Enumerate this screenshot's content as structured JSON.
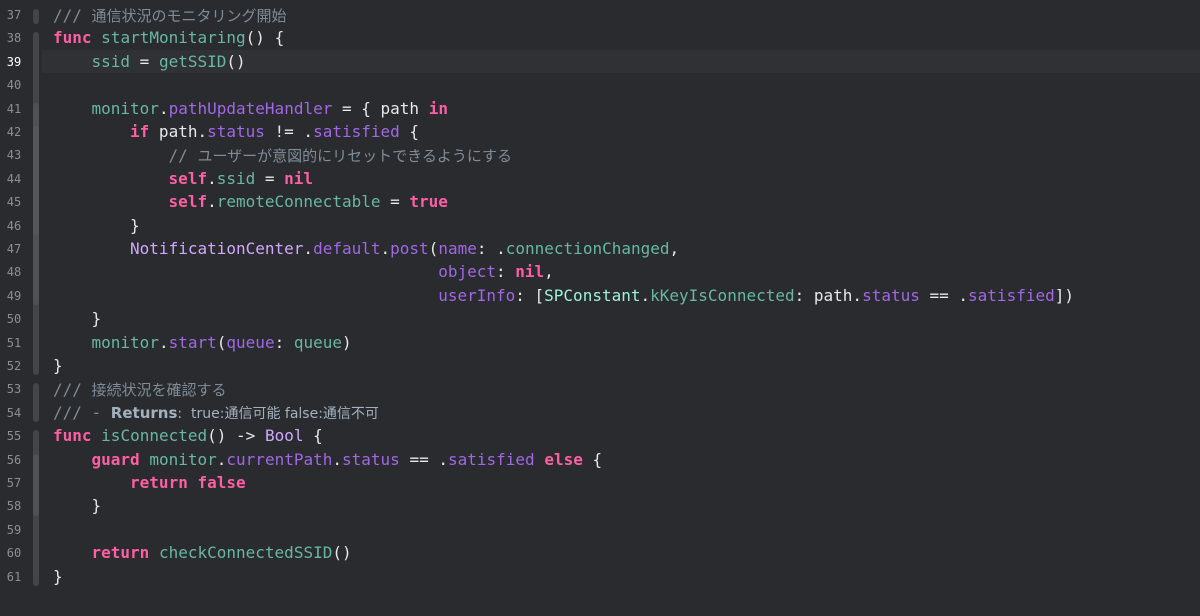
{
  "editor": {
    "active_line": "39",
    "lines": [
      {
        "n": "37",
        "indent": 1,
        "tokens": [
          {
            "t": "/// ",
            "c": "cm-mono"
          },
          {
            "t": "通信状況のモニタリング開始",
            "c": "cm"
          }
        ]
      },
      {
        "n": "38",
        "indent": 1,
        "tokens": [
          {
            "t": "func",
            "c": "kw"
          },
          {
            "t": " ",
            "c": "plain"
          },
          {
            "t": "startMonitaring",
            "c": "fn"
          },
          {
            "t": "() {",
            "c": "plain"
          }
        ]
      },
      {
        "n": "39",
        "indent": 2,
        "tokens": [
          {
            "t": "ssid",
            "c": "proj"
          },
          {
            "t": " = ",
            "c": "plain"
          },
          {
            "t": "getSSID",
            "c": "proj"
          },
          {
            "t": "()",
            "c": "plain"
          }
        ]
      },
      {
        "n": "40",
        "indent": 0,
        "tokens": []
      },
      {
        "n": "41",
        "indent": 2,
        "tokens": [
          {
            "t": "monitor",
            "c": "proj"
          },
          {
            "t": ".",
            "c": "plain"
          },
          {
            "t": "pathUpdateHandler",
            "c": "prop"
          },
          {
            "t": " = { path ",
            "c": "plain"
          },
          {
            "t": "in",
            "c": "kw"
          }
        ]
      },
      {
        "n": "42",
        "indent": 3,
        "tokens": [
          {
            "t": "if",
            "c": "kw"
          },
          {
            "t": " path.",
            "c": "plain"
          },
          {
            "t": "status",
            "c": "prop"
          },
          {
            "t": " != .",
            "c": "plain"
          },
          {
            "t": "satisfied",
            "c": "prop"
          },
          {
            "t": " {",
            "c": "plain"
          }
        ]
      },
      {
        "n": "43",
        "indent": 4,
        "tokens": [
          {
            "t": "// ",
            "c": "cm-mono"
          },
          {
            "t": "ユーザーが意図的にリセットできるようにする",
            "c": "cm"
          }
        ]
      },
      {
        "n": "44",
        "indent": 4,
        "tokens": [
          {
            "t": "self",
            "c": "kw"
          },
          {
            "t": ".",
            "c": "plain"
          },
          {
            "t": "ssid",
            "c": "proj"
          },
          {
            "t": " = ",
            "c": "plain"
          },
          {
            "t": "nil",
            "c": "kw"
          }
        ]
      },
      {
        "n": "45",
        "indent": 4,
        "tokens": [
          {
            "t": "self",
            "c": "kw"
          },
          {
            "t": ".",
            "c": "plain"
          },
          {
            "t": "remoteConnectable",
            "c": "proj"
          },
          {
            "t": " = ",
            "c": "plain"
          },
          {
            "t": "true",
            "c": "kw"
          }
        ]
      },
      {
        "n": "46",
        "indent": 3,
        "tokens": [
          {
            "t": "}",
            "c": "plain"
          }
        ]
      },
      {
        "n": "47",
        "indent": 3,
        "tokens": [
          {
            "t": "NotificationCenter",
            "c": "cls"
          },
          {
            "t": ".",
            "c": "plain"
          },
          {
            "t": "default",
            "c": "prop"
          },
          {
            "t": ".",
            "c": "plain"
          },
          {
            "t": "post",
            "c": "prop"
          },
          {
            "t": "(",
            "c": "plain"
          },
          {
            "t": "name",
            "c": "lbl"
          },
          {
            "t": ": .",
            "c": "plain"
          },
          {
            "t": "connectionChanged",
            "c": "proj"
          },
          {
            "t": ",",
            "c": "plain"
          }
        ]
      },
      {
        "n": "48",
        "indent": 11,
        "tokens": [
          {
            "t": "object",
            "c": "lbl"
          },
          {
            "t": ": ",
            "c": "plain"
          },
          {
            "t": "nil",
            "c": "kw"
          },
          {
            "t": ",",
            "c": "plain"
          }
        ]
      },
      {
        "n": "49",
        "indent": 11,
        "tokens": [
          {
            "t": "userInfo",
            "c": "lbl"
          },
          {
            "t": ": [",
            "c": "plain"
          },
          {
            "t": "SPConstant",
            "c": "type-proj"
          },
          {
            "t": ".",
            "c": "plain"
          },
          {
            "t": "kKeyIsConnected",
            "c": "proj"
          },
          {
            "t": ": path.",
            "c": "plain"
          },
          {
            "t": "status",
            "c": "prop"
          },
          {
            "t": " == .",
            "c": "plain"
          },
          {
            "t": "satisfied",
            "c": "prop"
          },
          {
            "t": "])",
            "c": "plain"
          }
        ]
      },
      {
        "n": "50",
        "indent": 2,
        "tokens": [
          {
            "t": "}",
            "c": "plain"
          }
        ]
      },
      {
        "n": "51",
        "indent": 2,
        "tokens": [
          {
            "t": "monitor",
            "c": "proj"
          },
          {
            "t": ".",
            "c": "plain"
          },
          {
            "t": "start",
            "c": "prop"
          },
          {
            "t": "(",
            "c": "plain"
          },
          {
            "t": "queue",
            "c": "lbl"
          },
          {
            "t": ": ",
            "c": "plain"
          },
          {
            "t": "queue",
            "c": "proj"
          },
          {
            "t": ")",
            "c": "plain"
          }
        ]
      },
      {
        "n": "52",
        "indent": 1,
        "tokens": [
          {
            "t": "}",
            "c": "plain"
          }
        ]
      },
      {
        "n": "53",
        "indent": 1,
        "tokens": [
          {
            "t": "/// ",
            "c": "cm-mono"
          },
          {
            "t": "接続状況を確認する",
            "c": "cm"
          }
        ]
      },
      {
        "n": "54",
        "indent": 1,
        "tokens": [
          {
            "t": "/// - ",
            "c": "cm-mono"
          },
          {
            "t": "Returns",
            "c": "doc-bold"
          },
          {
            "t": ":  true:通信可能 false:通信不可",
            "c": "doc"
          }
        ]
      },
      {
        "n": "55",
        "indent": 1,
        "tokens": [
          {
            "t": "func",
            "c": "kw"
          },
          {
            "t": " ",
            "c": "plain"
          },
          {
            "t": "isConnected",
            "c": "fn"
          },
          {
            "t": "() -> ",
            "c": "plain"
          },
          {
            "t": "Bool",
            "c": "cls"
          },
          {
            "t": " {",
            "c": "plain"
          }
        ]
      },
      {
        "n": "56",
        "indent": 2,
        "tokens": [
          {
            "t": "guard",
            "c": "kw"
          },
          {
            "t": " ",
            "c": "plain"
          },
          {
            "t": "monitor",
            "c": "proj"
          },
          {
            "t": ".",
            "c": "plain"
          },
          {
            "t": "currentPath",
            "c": "prop"
          },
          {
            "t": ".",
            "c": "plain"
          },
          {
            "t": "status",
            "c": "prop"
          },
          {
            "t": " == .",
            "c": "plain"
          },
          {
            "t": "satisfied",
            "c": "prop"
          },
          {
            "t": " ",
            "c": "plain"
          },
          {
            "t": "else",
            "c": "kw"
          },
          {
            "t": " {",
            "c": "plain"
          }
        ]
      },
      {
        "n": "57",
        "indent": 3,
        "tokens": [
          {
            "t": "return",
            "c": "kw"
          },
          {
            "t": " ",
            "c": "plain"
          },
          {
            "t": "false",
            "c": "kw"
          }
        ]
      },
      {
        "n": "58",
        "indent": 2,
        "tokens": [
          {
            "t": "}",
            "c": "plain"
          }
        ]
      },
      {
        "n": "59",
        "indent": 0,
        "tokens": []
      },
      {
        "n": "60",
        "indent": 2,
        "tokens": [
          {
            "t": "return",
            "c": "kw"
          },
          {
            "t": " ",
            "c": "plain"
          },
          {
            "t": "checkConnectedSSID",
            "c": "proj"
          },
          {
            "t": "()",
            "c": "plain"
          }
        ]
      },
      {
        "n": "61",
        "indent": 1,
        "tokens": [
          {
            "t": "}",
            "c": "plain"
          }
        ]
      }
    ]
  },
  "colors": {
    "background": "#2a2b2f",
    "active_line": "#2f3135",
    "keyword": "#fc5fa3",
    "comment": "#7f8c98",
    "project_symbol": "#67b7a4",
    "system_property": "#a167e6",
    "system_type": "#d0a8ff"
  }
}
